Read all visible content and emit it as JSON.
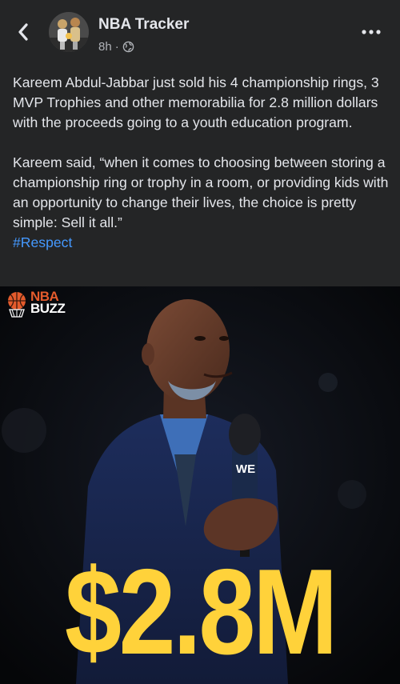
{
  "header": {
    "page_name": "NBA Tracker",
    "time": "8h",
    "separator": "·",
    "back_icon": "chevron-left-icon",
    "privacy_icon": "globe-icon",
    "more_icon": "more-horizontal-icon"
  },
  "post": {
    "paragraph1": "Kareem Abdul-Jabbar just sold his 4 championship rings, 3 MVP Trophies and other memorabilia for 2.8 million dollars with the proceeds going to a youth education program.",
    "paragraph2": "Kareem said, “when it comes to choosing between storing a championship ring or trophy in a room, or providing kids with an opportunity to change their lives, the choice is pretty simple: Sell it all.”",
    "hashtag": "#Respect"
  },
  "image": {
    "logo_top": "NBA",
    "logo_bottom": "BUZZ",
    "mic_label": "WE",
    "headline": "$2.8M"
  },
  "colors": {
    "background": "#242526",
    "text": "#e4e6eb",
    "muted": "#b0b3b8",
    "link": "#4599ff",
    "headline": "#ffd23a",
    "logo_accent": "#e45b2c"
  }
}
